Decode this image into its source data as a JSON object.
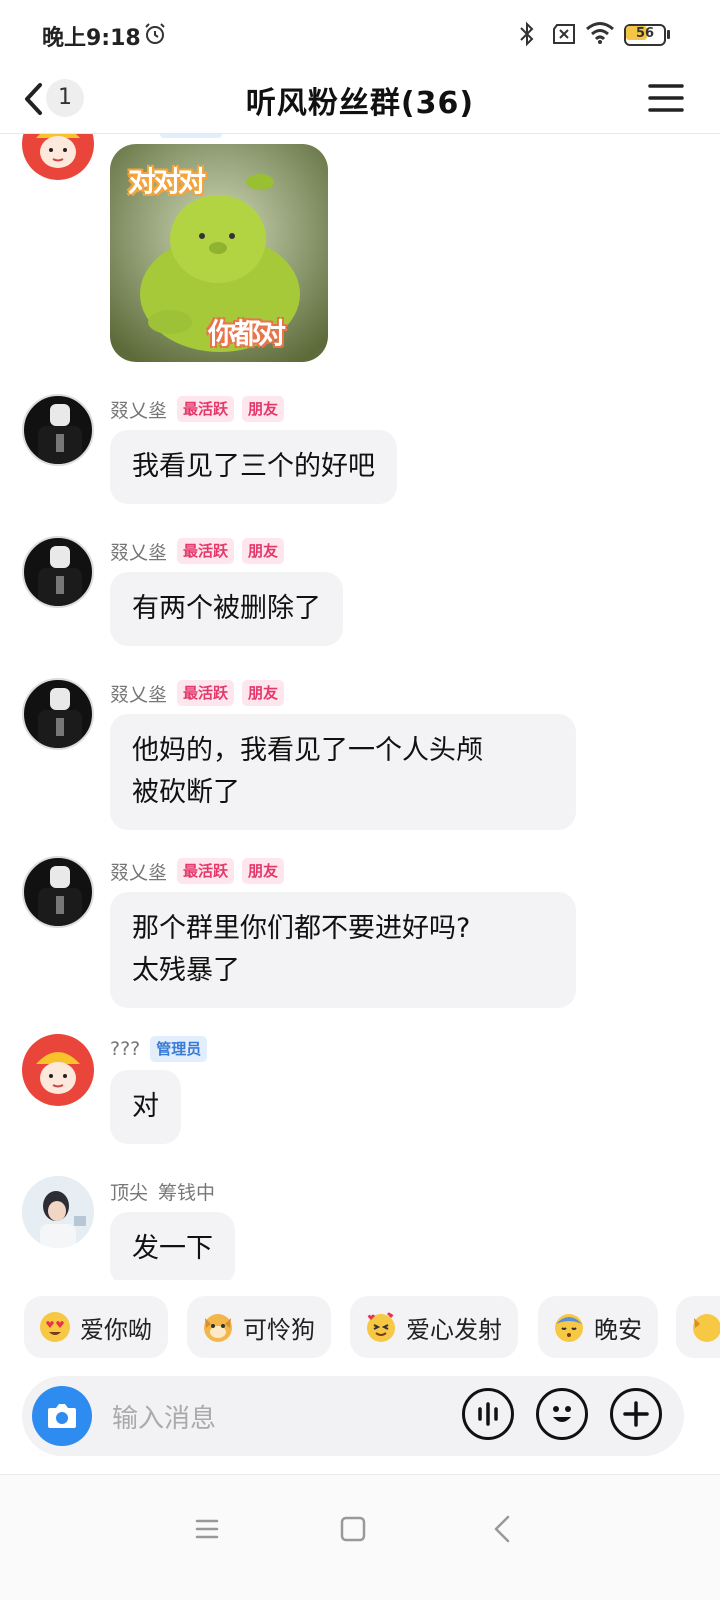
{
  "status_bar": {
    "time": "晚上9:18",
    "battery_level": "56",
    "battery_fraction": 0.56
  },
  "header": {
    "unread_count": "1",
    "title": "听风粉丝群(36)"
  },
  "messages": [
    {
      "sender": "???",
      "type": "sticker",
      "sticker_text_top": "对对对",
      "sticker_text_bottom": "你都对"
    },
    {
      "sender": "叕乂烾",
      "tags": [
        "最活跃",
        "朋友"
      ],
      "text": "我看见了三个的好吧"
    },
    {
      "sender": "叕乂烾",
      "tags": [
        "最活跃",
        "朋友"
      ],
      "text": "有两个被删除了"
    },
    {
      "sender": "叕乂烾",
      "tags": [
        "最活跃",
        "朋友"
      ],
      "text_line1": "他妈的，我看见了一个人头颅",
      "text_line2": "被砍断了"
    },
    {
      "sender": "叕乂烾",
      "tags": [
        "最活跃",
        "朋友"
      ],
      "text_line1": "那个群里你们都不要进好吗?",
      "text_line2": "太残暴了"
    },
    {
      "sender": "???",
      "tags": [
        "管理员"
      ],
      "text": "对"
    },
    {
      "sender": "顶尖",
      "status": "筹钱中",
      "text": "发一下"
    }
  ],
  "quick_replies": [
    {
      "label": "爱你呦",
      "icon": "heart-eyes-emoji-icon"
    },
    {
      "label": "可怜狗",
      "icon": "dog-face-emoji-icon"
    },
    {
      "label": "爱心发射",
      "icon": "hearts-face-emoji-icon"
    },
    {
      "label": "晚安",
      "icon": "sleeping-face-emoji-icon"
    }
  ],
  "input": {
    "placeholder": "输入消息"
  },
  "colors": {
    "accent_blue": "#2e8cf0",
    "tag_pink": "#e4396a",
    "tag_admin_blue": "#3a7bd5",
    "bubble_bg": "#f3f3f5"
  }
}
